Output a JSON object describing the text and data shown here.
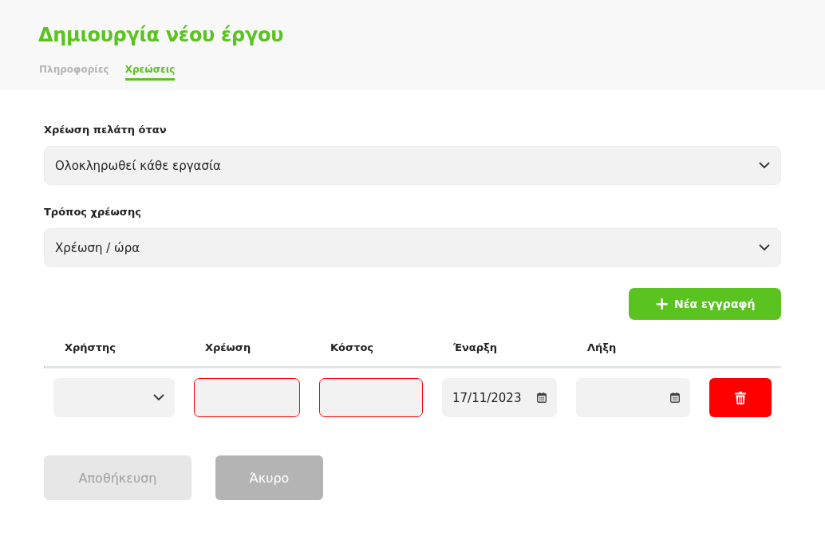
{
  "title": "Δημιουργία νέου έργου",
  "tabs": [
    {
      "label": "Πληροφορίες",
      "selected": false
    },
    {
      "label": "Χρεώσεις",
      "selected": true
    }
  ],
  "form": [
    {
      "label": "Χρέωση πελάτη όταν",
      "value": "Ολοκληρωθεί κάθε εργασία"
    },
    {
      "label": "Τρόπος χρέωσης",
      "value": "Χρέωση / ώρα"
    }
  ],
  "add_button": {
    "icon": "+",
    "label": "Νέα εγγραφή"
  },
  "table": {
    "columns": [
      "Χρήστης",
      "Χρέωση",
      "Κόστος",
      "Έναρξη",
      "Λήξη"
    ],
    "rows": [
      {
        "cells": [
          {
            "kind": "select",
            "invalid": false
          },
          {
            "kind": "text",
            "invalid": true
          },
          {
            "kind": "text",
            "invalid": true
          },
          {
            "kind": "date",
            "value": "17/11/2023",
            "invalid": false
          },
          {
            "kind": "date",
            "invalid": false
          }
        ]
      }
    ]
  },
  "buttons": [
    {
      "label": "Αποθήκευση",
      "disabled": true
    },
    {
      "label": "Άκυρο",
      "disabled": false
    }
  ]
}
